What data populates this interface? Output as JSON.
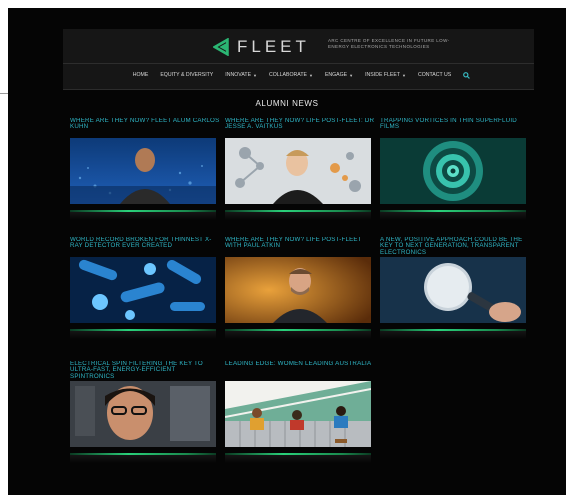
{
  "site": {
    "logo_text": "FLEET",
    "tagline": "ARC CENTRE OF EXCELLENCE IN FUTURE LOW-ENERGY ELECTRONICS TECHNOLOGIES",
    "accent": "#2fb6c6",
    "logo_color": "#2bb673"
  },
  "nav": {
    "items": [
      {
        "label": "HOME",
        "dropdown": false
      },
      {
        "label": "EQUITY & DIVERSITY",
        "dropdown": false
      },
      {
        "label": "INNOVATE",
        "dropdown": true
      },
      {
        "label": "COLLABORATE",
        "dropdown": true
      },
      {
        "label": "ENGAGE",
        "dropdown": true
      },
      {
        "label": "INSIDE FLEET",
        "dropdown": true
      },
      {
        "label": "CONTACT US",
        "dropdown": false
      }
    ],
    "search_icon": "search-icon"
  },
  "page": {
    "title": "ALUMNI NEWS"
  },
  "articles": [
    {
      "title": "WHERE ARE THEY NOW? FLEET ALUM CARLOS KUHN",
      "image": "portrait-man-city-lights"
    },
    {
      "title": "WHERE ARE THEY NOW? LIFE POST-FLEET: DR JESSE A. VAITKUS",
      "image": "portrait-man-molecules"
    },
    {
      "title": "TRAPPING VORTICES IN THIN SUPERFLUID FILMS",
      "image": "teal-spiral-vortex"
    },
    {
      "title": "WORLD RECORD BROKEN FOR THINNEST X-RAY DETECTOR EVER CREATED",
      "image": "blue-bacteria-illustration"
    },
    {
      "title": "WHERE ARE THEY NOW? LIFE POST-FLEET WITH PAUL ATKIN",
      "image": "portrait-man-warm-background"
    },
    {
      "title": "A NEW, POSITIVE APPROACH COULD BE THE KEY TO NEXT GENERATION, TRANSPARENT ELECTRONICS",
      "image": "magnifying-glass-hand"
    },
    {
      "title": "ELECTRICAL SPIN FILTERING THE KEY TO ULTRA-FAST, ENERGY-EFFICIENT SPINTRONICS",
      "image": "portrait-woman-lab"
    },
    {
      "title": "LEADING EDGE: WOMEN LEADING AUSTRALIA",
      "image": "cartoon-people-over-fence"
    }
  ]
}
